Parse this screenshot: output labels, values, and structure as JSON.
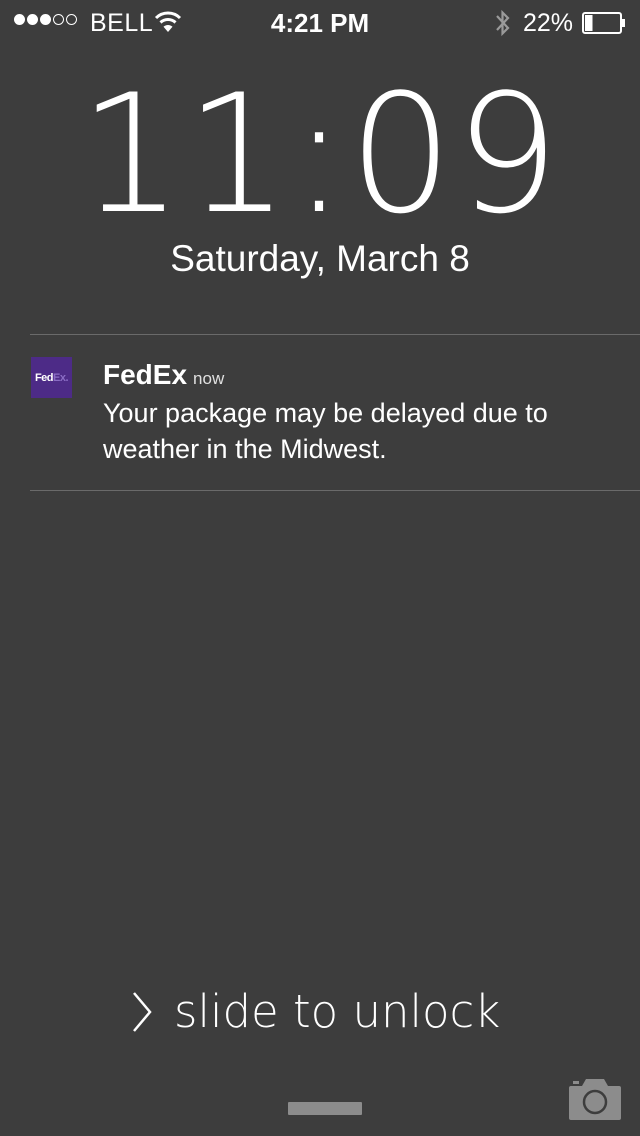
{
  "status_bar": {
    "carrier": "BELL",
    "signal_bars_filled": 3,
    "signal_bars_total": 5,
    "time": "4:21 PM",
    "battery_percent_label": "22%",
    "battery_level": 0.22
  },
  "lock_screen": {
    "time": "11:09",
    "time_hours": "11",
    "time_minutes": "09",
    "date": "Saturday, March 8"
  },
  "notification": {
    "app_name": "FedEx",
    "timestamp": "now",
    "message": "Your package may be delayed due to weather in the Midwest.",
    "icon": "fedex-icon",
    "icon_color": "#4d2b87",
    "logo_text_fed": "Fed",
    "logo_text_ex": "Ex."
  },
  "unlock": {
    "label": "slide to unlock"
  },
  "colors": {
    "background": "#3d3d3d",
    "divider": "#6a6a6a",
    "grabber": "#8c8c8c"
  }
}
